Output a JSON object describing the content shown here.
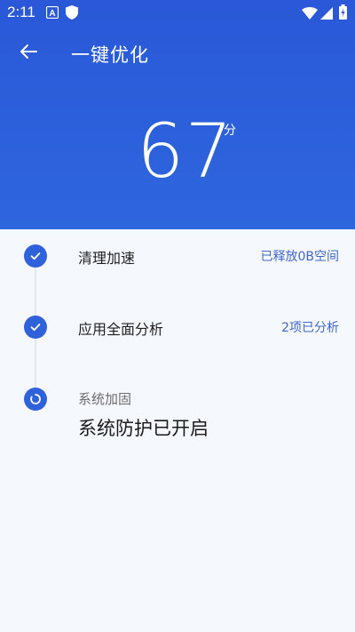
{
  "status_bar": {
    "time": "2:11"
  },
  "header": {
    "title": "一键优化",
    "score": "67",
    "score_unit": "分"
  },
  "steps": [
    {
      "label": "清理加速",
      "status": "已释放0B空间",
      "state": "done"
    },
    {
      "label": "应用全面分析",
      "status": "2项已分析",
      "state": "done"
    },
    {
      "label": "系统加固",
      "detail": "系统防护已开启",
      "state": "in-progress"
    }
  ],
  "colors": {
    "header_bg": "#2a58d8",
    "accent": "#2f61da",
    "status_text": "#3f66c9",
    "page_bg": "#f5f8fd"
  }
}
